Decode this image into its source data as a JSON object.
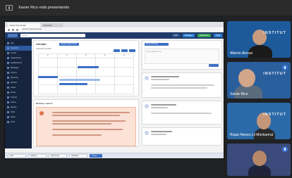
{
  "meeting": {
    "presenting_text": "Xavier Rico está presentando"
  },
  "browser": {
    "tabs": [
      "Institut Tecnològic",
      "Calendari"
    ],
    "address": "campus.institut.edu/aula"
  },
  "app": {
    "search_placeholder": "Cercar...",
    "top_buttons": [
      {
        "label": "Perfil",
        "color": "#2d4f86"
      },
      {
        "label": "Missatges",
        "color": "#2e7fd0"
      },
      {
        "label": "Notificacions",
        "color": "#2fa14f"
      },
      {
        "label": "Sortir",
        "color": "#2e7fd0"
      }
    ],
    "sidebar_items": [
      "Inici",
      "Calendari",
      "Cursos",
      "Assignatures",
      "Qualificacions",
      "Missatges",
      "Fòrums",
      "Recursos",
      "Notícies",
      "Grups",
      "Arxius",
      "Tutories",
      "Avisos",
      "Ajustos",
      "Perfil",
      "Ajuda",
      "Sortir"
    ],
    "calendar": {
      "title": "Calendari",
      "button": "Afegir esdeveniment",
      "subtitle": "novembre de 2021",
      "days": [
        "dl.",
        "dt.",
        "dc.",
        "dj.",
        "dv."
      ]
    },
    "news": {
      "title": "Notícies i avisos"
    },
    "wall": {
      "post_button": "Nova publicació",
      "post_placeholder": "Escriu alguna cosa..."
    },
    "taskbar": [
      "Aula",
      "Campus",
      "Documents",
      "Calendari",
      "Correu"
    ]
  },
  "participants": [
    {
      "name": "Alberto Alonso",
      "wordmark": "INSTITUT",
      "bg": "#1d5a9c"
    },
    {
      "name": "Xavier Rico",
      "wordmark": "INSTITUT",
      "bg": "#2a5f9e"
    },
    {
      "name": "Rojas Nieves Lil Montserrat",
      "wordmark": "INSTITUT",
      "bg": "#2b6aa8"
    },
    {
      "name": "",
      "wordmark": "",
      "bg": "#3a4a7a"
    }
  ]
}
